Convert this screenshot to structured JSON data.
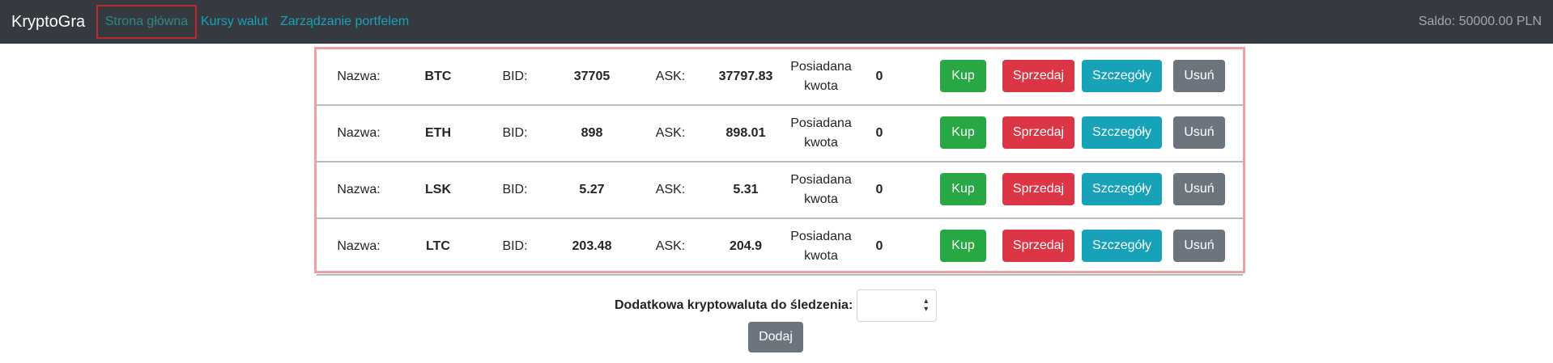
{
  "navbar": {
    "brand": "KryptoGra",
    "home": "Strona główna",
    "rates": "Kursy walut",
    "portfolio": "Zarządzanie portfelem",
    "balance": "Saldo: 50000.00 PLN"
  },
  "labels": {
    "name": "Nazwa:",
    "bid": "BID:",
    "ask": "ASK:",
    "owned_line1": "Posiadana",
    "owned_line2": "kwota"
  },
  "buttons": {
    "buy": "Kup",
    "sell": "Sprzedaj",
    "details": "Szczegóły",
    "remove": "Usuń"
  },
  "rows": [
    {
      "name": "BTC",
      "bid": "37705",
      "ask": "37797.83",
      "amount": "0"
    },
    {
      "name": "ETH",
      "bid": "898",
      "ask": "898.01",
      "amount": "0"
    },
    {
      "name": "LSK",
      "bid": "5.27",
      "ask": "5.31",
      "amount": "0"
    },
    {
      "name": "LTC",
      "bid": "203.48",
      "ask": "204.9",
      "amount": "0"
    }
  ],
  "add_form": {
    "label": "Dodatkowa kryptowaluta do śledzenia:",
    "selected": "",
    "button": "Dodaj"
  },
  "colors": {
    "navbar": "#343a40",
    "buy": "#28a745",
    "sell": "#dc3545",
    "details": "#17a2b8",
    "remove": "#6c757d"
  }
}
